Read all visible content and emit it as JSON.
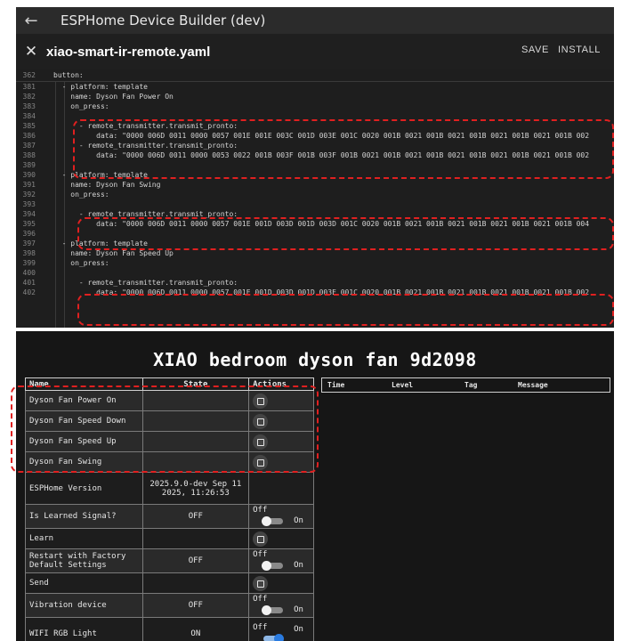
{
  "editor": {
    "app_title": "ESPHome Device Builder (dev)",
    "file_title": "xiao-smart-ir-remote.yaml",
    "save_label": "SAVE",
    "install_label": "INSTALL",
    "icons": {
      "back": "back-arrow-icon",
      "close": "close-icon"
    },
    "sticky_line": {
      "number": "362",
      "text": "button:"
    },
    "lines": [
      {
        "number": "381",
        "text": "  - platform: template"
      },
      {
        "number": "382",
        "text": "    name: Dyson Fan Power On"
      },
      {
        "number": "383",
        "text": "    on_press:"
      },
      {
        "number": "384",
        "text": ""
      },
      {
        "number": "385",
        "text": "      - remote_transmitter.transmit_pronto:"
      },
      {
        "number": "386",
        "text": "          data: \"0000 006D 0011 0000 0057 001E 001E 003C 001D 003E 001C 0020 001B 0021 001B 0021 001B 0021 001B 0021 001B 002"
      },
      {
        "number": "387",
        "text": "      - remote_transmitter.transmit_pronto:"
      },
      {
        "number": "388",
        "text": "          data: \"0000 006D 0011 0000 0053 0022 001B 003F 001B 003F 001B 0021 001B 0021 001B 0021 001B 0021 001B 0021 001B 002"
      },
      {
        "number": "389",
        "text": ""
      },
      {
        "number": "390",
        "text": "  - platform: template"
      },
      {
        "number": "391",
        "text": "    name: Dyson Fan Swing"
      },
      {
        "number": "392",
        "text": "    on_press:"
      },
      {
        "number": "393",
        "text": ""
      },
      {
        "number": "394",
        "text": "      - remote_transmitter.transmit_pronto:"
      },
      {
        "number": "395",
        "text": "          data: \"0000 006D 0011 0000 0057 001E 001D 003D 001D 003D 001C 0020 001B 0021 001B 0021 001B 0021 001B 0021 001B 004"
      },
      {
        "number": "396",
        "text": ""
      },
      {
        "number": "397",
        "text": "  - platform: template"
      },
      {
        "number": "398",
        "text": "    name: Dyson Fan Speed Up"
      },
      {
        "number": "399",
        "text": "    on_press:"
      },
      {
        "number": "400",
        "text": ""
      },
      {
        "number": "401",
        "text": "      - remote_transmitter.transmit_pronto:"
      },
      {
        "number": "402",
        "text": "          data: \"0000 006D 0011 0000 0057 001E 001D 003D 001D 003E 001C 0020 001B 0021 001B 0021 001B 0021 001B 0021 001B 002"
      }
    ]
  },
  "device": {
    "title": "XIAO bedroom dyson fan 9d2098",
    "columns": {
      "name": "Name",
      "state": "State",
      "actions": "Actions"
    },
    "log_columns": {
      "time": "Time",
      "level": "Level",
      "tag": "Tag",
      "message": "Message"
    },
    "toggle_off": "Off",
    "toggle_on": "On",
    "icons": {
      "press": "press-button-icon"
    },
    "rows": [
      {
        "name": "Dyson Fan Power On"
      },
      {
        "name": "Dyson Fan Speed Down"
      },
      {
        "name": "Dyson Fan Speed Up"
      },
      {
        "name": "Dyson Fan Swing"
      },
      {
        "name": "ESPHome Version",
        "state": "2025.9.0-dev Sep 11 2025, 11:26:53"
      },
      {
        "name": "Is Learned Signal?",
        "state": "OFF",
        "switch_on": false
      },
      {
        "name": "Learn"
      },
      {
        "name": "Restart with Factory Default Settings",
        "state": "OFF",
        "switch_on": false
      },
      {
        "name": "Send"
      },
      {
        "name": "Vibration device",
        "state": "OFF",
        "switch_on": false
      },
      {
        "name": "WIFI RGB Light",
        "state": "ON",
        "switch_on": true
      }
    ]
  },
  "colors": {
    "highlight": "#e02020",
    "switch_on": "#2a7be0"
  }
}
